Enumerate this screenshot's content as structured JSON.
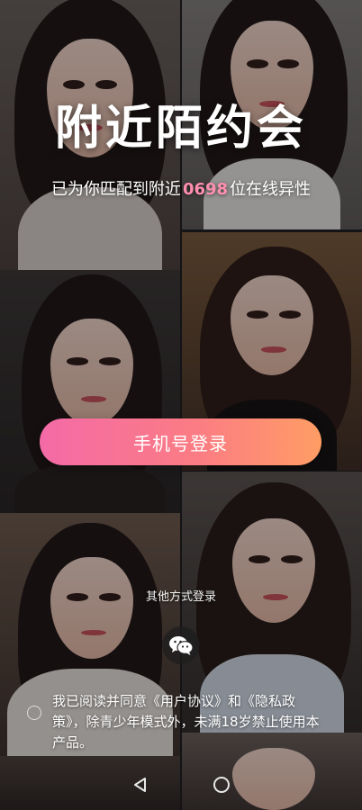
{
  "hero": {
    "title": "附近陌约会",
    "subtitle_prefix": "已为你匹配到附近",
    "subtitle_count": "0698",
    "subtitle_suffix": "位在线异性"
  },
  "actions": {
    "phone_login_label": "手机号登录",
    "other_methods_label": "其他方式登录"
  },
  "agreement": {
    "prefix": "我已阅读并同意",
    "user_agreement": "《用户协议》",
    "connector": "和",
    "privacy_policy": "《隐私政策》",
    "suffix": "，除青少年模式外，未满18岁禁止使用本产品。",
    "checked": false
  },
  "icons": [
    "wechat-icon",
    "nav-back-icon",
    "nav-home-icon"
  ],
  "colors": {
    "button_gradient_start": "#f46aa7",
    "button_gradient_end": "#ff9d64",
    "count_accent": "#ff8fb0"
  }
}
